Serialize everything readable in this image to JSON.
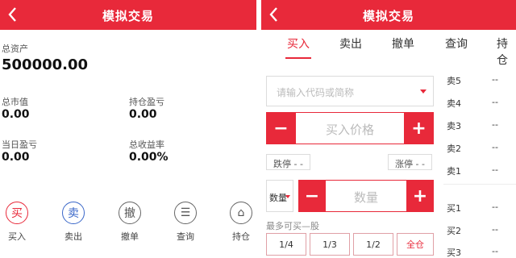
{
  "left_screen": {
    "header": {
      "title": "模拟交易",
      "back_icon": "chevron-left-icon"
    },
    "total_assets": {
      "label": "总资产",
      "value": "500000.00"
    },
    "market_value": {
      "label": "总市值",
      "value": "0.00"
    },
    "position_pnl": {
      "label": "持仓盈亏",
      "value": "0.00"
    },
    "daily_pnl": {
      "label": "当日盈亏",
      "value": "0.00"
    },
    "total_return": {
      "label": "总收益率",
      "value": "0.00%"
    },
    "actions": [
      {
        "glyph": "买",
        "label": "买入",
        "icon": "buy-icon"
      },
      {
        "glyph": "卖",
        "label": "卖出",
        "icon": "sell-icon"
      },
      {
        "glyph": "撤",
        "label": "撤单",
        "icon": "cancel-order-icon"
      },
      {
        "glyph": "☰",
        "label": "查询",
        "icon": "query-icon"
      },
      {
        "glyph": "⌂",
        "label": "持仓",
        "icon": "position-icon"
      }
    ]
  },
  "right_screen": {
    "header": {
      "title": "模拟交易",
      "back_icon": "chevron-left-icon"
    },
    "tabs": [
      {
        "label": "买入",
        "active": true
      },
      {
        "label": "卖出",
        "active": false
      },
      {
        "label": "撤单",
        "active": false
      },
      {
        "label": "查询",
        "active": false
      },
      {
        "label": "持仓",
        "active": false
      }
    ],
    "stock_select": {
      "placeholder": "请输入代码或简称"
    },
    "price_stepper": {
      "minus": "−",
      "placeholder": "买入价格",
      "plus": "+"
    },
    "limit_down": "跌停 - -",
    "limit_up": "涨停 - -",
    "qty_unit": "数量",
    "qty_stepper": {
      "minus": "−",
      "placeholder": "数量",
      "plus": "+"
    },
    "max_buy": "最多可买—股",
    "quick_buttons": [
      "1/4",
      "1/3",
      "1/2",
      "全仓"
    ],
    "order_book": {
      "sell": [
        {
          "label": "卖5",
          "value": "--"
        },
        {
          "label": "卖4",
          "value": "--"
        },
        {
          "label": "卖3",
          "value": "--"
        },
        {
          "label": "卖2",
          "value": "--"
        },
        {
          "label": "卖1",
          "value": "--"
        }
      ],
      "buy": [
        {
          "label": "买1",
          "value": "--"
        },
        {
          "label": "买2",
          "value": "--"
        },
        {
          "label": "买3",
          "value": "--"
        }
      ]
    }
  },
  "colors": {
    "brand_red": "#e8293a",
    "blue": "#3a67c9",
    "text": "#222222",
    "muted": "#bbbbbb"
  }
}
